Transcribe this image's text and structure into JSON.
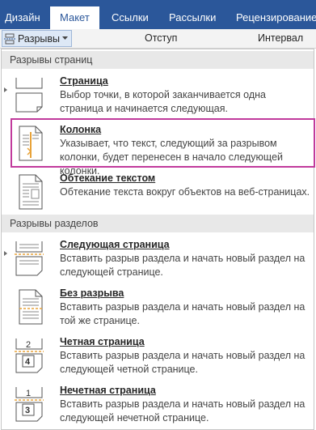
{
  "ribbon": {
    "tabs": [
      {
        "label": "Дизайн"
      },
      {
        "label": "Макет"
      },
      {
        "label": "Ссылки"
      },
      {
        "label": "Рассылки"
      },
      {
        "label": "Рецензирование"
      }
    ],
    "active_tab": "Макет"
  },
  "toolbar": {
    "breaks_label": "Разрывы",
    "indent_label": "Отступ",
    "spacing_label": "Интервал"
  },
  "menu": {
    "page_breaks_header": "Разрывы страниц",
    "section_breaks_header": "Разрывы разделов",
    "items": [
      {
        "icon": "page-break-icon",
        "title": "Страница",
        "desc": "Выбор точки, в которой заканчивается одна страница и начинается следующая."
      },
      {
        "icon": "column-break-icon",
        "title": "Колонка",
        "desc": "Указывает, что текст, следующий за разрывом колонки, будет перенесен в начало следующей колонки."
      },
      {
        "icon": "text-wrapping-icon",
        "title": "Обтекание текстом",
        "desc": "Обтекание текста вокруг объектов на веб-страницах."
      },
      {
        "icon": "next-page-section-icon",
        "title": "Следующая страница",
        "desc": "Вставить разрыв раздела и начать новый раздел на следующей странице."
      },
      {
        "icon": "continuous-section-icon",
        "title": "Без разрыва",
        "desc": "Вставить разрыв раздела и начать новый раздел на той же странице."
      },
      {
        "icon": "even-page-section-icon",
        "title": "Четная страница",
        "desc": "Вставить разрыв раздела и начать новый раздел на следующей четной странице."
      },
      {
        "icon": "odd-page-section-icon",
        "title": "Нечетная страница",
        "desc": "Вставить разрыв раздела и начать новый раздел на следующей нечетной странице."
      }
    ]
  },
  "colors": {
    "ribbon_blue": "#2b579a",
    "highlight_magenta": "#c13a9c",
    "icon_orange": "#e8a33a"
  }
}
